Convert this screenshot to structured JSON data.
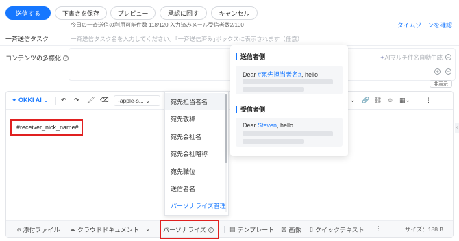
{
  "actions": {
    "send": "送信する",
    "save_draft": "下書きを保存",
    "preview": "プレビュー",
    "approval": "承認に回す",
    "cancel": "キャンセル"
  },
  "quota_text": "今日の一斉送信の利用可能件数 118/120 入力済みメール受信者数2/100",
  "timezone_link": "タイムゾーンを確認",
  "bulk_task": {
    "label": "一斉送信タスク",
    "placeholder": "一斉送信タスク名を入力してください。｢一斉送信済み｣ボックスに表示されます（任意）"
  },
  "content_diversify": {
    "label": "コンテンツの多様化",
    "ai_subject": "AIマルチ件名自動生成",
    "hide": "非表示"
  },
  "toolbar": {
    "okki": "OKKI AI",
    "font": "-apple-s...",
    "undo": "↶",
    "redo": "↷",
    "format_painter": "🖌",
    "clear": "⌫",
    "more": "⋮"
  },
  "editor": {
    "nick_name": "#receiver_nick_name#"
  },
  "dropdown": {
    "items": [
      "宛先担当者名",
      "宛先敬称",
      "宛先会社名",
      "宛先会社略称",
      "宛先職位",
      "送信者名"
    ],
    "manage": "パーソナライズ管理"
  },
  "preview": {
    "sender_title": "送信者側",
    "sender_prefix": "Dear ",
    "sender_var": "#宛先担当者名#",
    "sender_suffix": ", hello",
    "receiver_title": "受信者側",
    "receiver_prefix": "Dear ",
    "receiver_name": "Steven",
    "receiver_suffix": ", hello"
  },
  "bottom": {
    "attachment": "添付ファイル",
    "cloud_doc": "クラウドドキュメント",
    "personalize": "パーソナライズ",
    "template": "テンプレート",
    "image": "画像",
    "quick_text": "クイックテキスト",
    "more": "⋮",
    "size": "サイズ：188 B"
  },
  "colors": {
    "primary": "#1677ff",
    "highlight_border": "#e02020"
  }
}
